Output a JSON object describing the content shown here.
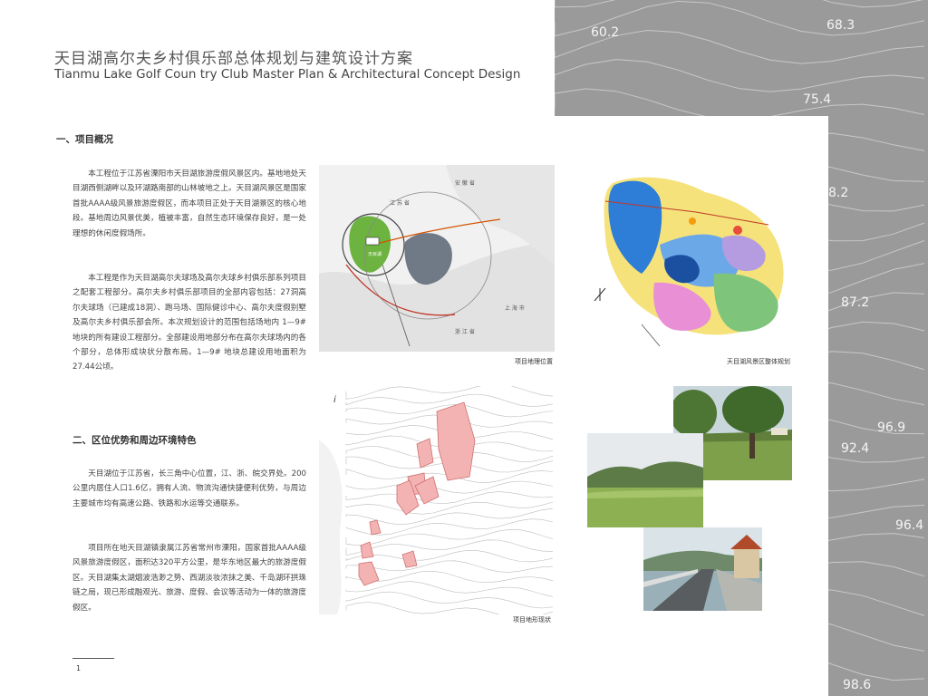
{
  "title": {
    "cn": "天目湖高尔夫乡村俱乐部总体规划与建筑设计方案",
    "en": "Tianmu Lake Golf Coun try Club Master Plan & Architectural Concept Design"
  },
  "sections": [
    {
      "heading": "一、项目概况",
      "paragraphs": [
        "本工程位于江苏省溧阳市天目湖旅游度假风景区内。基地地处天目湖西侧湖畔以及环湖路南部的山林坡地之上。天目湖风景区是国家首批AAAA级风景旅游度假区，而本项目正处于天目湖景区的核心地段。基地周边风景优美，植被丰富，自然生态环境保存良好，是一处理想的休闲度假场所。",
        "本工程是作为天目湖高尔夫球场及高尔夫球乡村俱乐部系列项目之配套工程部分。高尔夫乡村俱乐部项目的全部内容包括：27洞高尔夫球场（已建成18洞）、跑马场、国际健诊中心、高尔夫度假别墅及高尔夫乡村俱乐部会所。本次规划设计的范围包括场地内 1—9# 地块的所有建设工程部分。全部建设用地部分布在高尔夫球场内的各个部分，总体形成块状分散布局。1—9# 地块总建设用地面积为27.44公顷。"
      ]
    },
    {
      "heading": "二、区位优势和周边环境特色",
      "paragraphs": [
        "天目湖位于江苏省，长三角中心位置，江、浙、皖交界处。200公里内居住人口1.6亿，拥有人流、物流沟通快捷便利优势，与周边主要城市均有高速公路、铁路和水运等交通联系。",
        "项目所在地天目湖镇隶属江苏省常州市溧阳，国家首批AAAA级风景旅游度假区，面积达320平方公里，是华东地区最大的旅游度假区。天目湖集太湖烟波浩渺之势、西湖淡妆浓抹之美、千岛湖环拱珠链之局，现已形成融观光、旅游、度假、会议等活动为一体的旅游度假区。"
      ]
    }
  ],
  "figures": {
    "location_map": {
      "caption": "项目地理位置",
      "labels": [
        "江 苏 省",
        "安 徽 省",
        "上 海 市",
        "浙 江 省",
        "天目湖"
      ]
    },
    "scenic_plan": {
      "caption": "天目湖风景区整体规划"
    },
    "terrain_plan": {
      "caption": "项目地形现状"
    },
    "photos": [
      "golf-course-tree-photo",
      "fairway-hills-photo",
      "lakeside-road-pavilion-photo"
    ]
  },
  "contour_elevations": [
    "60.2",
    "68.3",
    "75.4",
    "8.2",
    "87.2",
    "96.9",
    "92.4",
    "96.4",
    "98.6"
  ],
  "page_number": "1",
  "colors": {
    "background_contour": "#9a9a9a",
    "contour_line": "#c8c8c8"
  }
}
